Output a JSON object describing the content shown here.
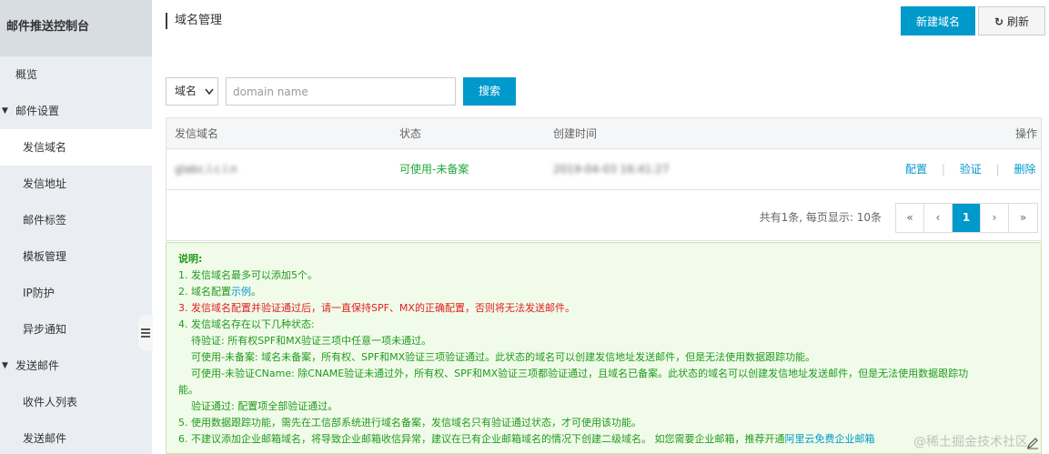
{
  "sidebar": {
    "title": "邮件推送控制台",
    "items": [
      {
        "label": "概览",
        "level": 1
      },
      {
        "label": "邮件设置",
        "level": 1,
        "caret": "▼"
      },
      {
        "label": "发信域名",
        "level": 2,
        "active": true
      },
      {
        "label": "发信地址",
        "level": 2
      },
      {
        "label": "邮件标签",
        "level": 2
      },
      {
        "label": "模板管理",
        "level": 2
      },
      {
        "label": "IP防护",
        "level": 2
      },
      {
        "label": "异步通知",
        "level": 2
      },
      {
        "label": "发送邮件",
        "level": 1,
        "caret": "▼"
      },
      {
        "label": "收件人列表",
        "level": 2
      },
      {
        "label": "发送邮件",
        "level": 2
      }
    ]
  },
  "header": {
    "title": "域名管理",
    "new_domain_label": "新建域名",
    "refresh_label": "刷新",
    "refresh_icon": "↻"
  },
  "search": {
    "select_value": "域名",
    "placeholder": "domain name",
    "button_label": "搜索"
  },
  "table": {
    "columns": [
      "发信域名",
      "状态",
      "创建时间",
      "操作"
    ],
    "rows": [
      {
        "domain": "glabc.l.c.l.n",
        "status": "可使用-未备案",
        "created": "2019-04-03 16:41:27",
        "actions": [
          "配置",
          "验证",
          "删除"
        ]
      }
    ],
    "separator": "|"
  },
  "pagination": {
    "summary": "共有1条, 每页显示: 10条",
    "first": "«",
    "prev": "‹",
    "current": "1",
    "next": "›",
    "last": "»"
  },
  "notice": {
    "title": "说明:",
    "line1": "1. 发信域名最多可以添加5个。",
    "line2_prefix": "2. 域名配置",
    "line2_link": "示例",
    "line2_suffix": "。",
    "line3": "3. 发信域名配置并验证通过后，请一直保持SPF、MX的正确配置，否则将无法发送邮件。",
    "line4": "4. 发信域名存在以下几种状态:",
    "line4a": "待验证: 所有权SPF和MX验证三项中任意一项未通过。",
    "line4b": "可使用-未备案: 域名未备案，所有权、SPF和MX验证三项验证通过。此状态的域名可以创建发信地址发送邮件，但是无法使用数据跟踪功能。",
    "line4c": "可使用-未验证CName: 除CNAME验证未通过外，所有权、SPF和MX验证三项都验证通过，且域名已备案。此状态的域名可以创建发信地址发送邮件，但是无法使用数据跟踪功",
    "line4c_wrap": "能。",
    "line4d": "验证通过: 配置项全部验证通过。",
    "line5": "5. 使用数据跟踪功能，需先在工信部系统进行域名备案，发信域名只有验证通过状态，才可使用该功能。",
    "line6_prefix": "6. 不建议添加企业邮箱域名，将导致企业邮箱收信异常，建议在已有企业邮箱域名的情况下创建二级域名。 如您需要企业邮箱，推荐开通",
    "line6_link": "阿里云免费企业邮箱",
    "watermark": "@稀土掘金技术社区"
  },
  "colors": {
    "primary": "#0099cc",
    "success": "#1fa83a",
    "danger": "#e0211f",
    "notice_bg": "#f1fbe9"
  },
  "icons": {
    "collapse": "menu-collapse-icon",
    "refresh": "refresh-icon",
    "caret": "caret-down-icon",
    "edit": "edit-pencil-icon"
  }
}
